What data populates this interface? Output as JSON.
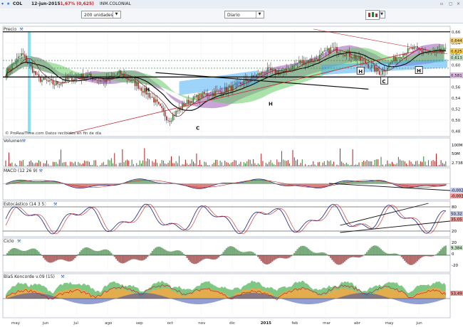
{
  "header": {
    "ticker": "COL",
    "date": "12-jun-2015",
    "change": "-1,67% (0,625)",
    "company": "INM.COLONIAL"
  },
  "toolbar": {
    "units_select": "200 unidades",
    "period_select": "Diario"
  },
  "watermark": "© ProRealTime.com  Datos recibidos en fin de día",
  "panels": {
    "price": "Precio",
    "volume": "Volumen",
    "macd": "MACD (12 26 9)",
    "stoch": "Estocástico (14 3 5)",
    "cycle": "Ciclo",
    "koncorde": "BlaS Koncorde v.09 (15)"
  },
  "price_ticks": [
    "0,66",
    "0,64",
    "0,62",
    "0,60",
    "0,58",
    "0,56",
    "0,54",
    "0,52",
    "0,50",
    "0,48"
  ],
  "price_badges": [
    "0,644",
    "0,625",
    "0,613",
    "0,581"
  ],
  "volume_ticks": [
    "100M",
    "50M"
  ],
  "volume_badge": "2.738",
  "macd_badges": [
    "-0,002",
    "-0,003"
  ],
  "stoch_ticks": [
    "80",
    "20"
  ],
  "stoch_badges": [
    "50,32",
    "35,05"
  ],
  "cycle_ticks": [
    "20",
    "0",
    "-20"
  ],
  "cycle_badge": "9,384",
  "koncorde_badge": "53,49",
  "pattern_labels": [
    "H",
    "C",
    "H",
    "H",
    "C",
    "H"
  ],
  "months": [
    "may",
    "jun",
    "jul",
    "ago",
    "sep",
    "oct",
    "nov",
    "dic",
    "2015",
    "feb",
    "mar",
    "abr",
    "may",
    "jun"
  ],
  "colors": {
    "candle_up": "#2e7d32",
    "candle_down": "#b71c1c",
    "cloud_purple": "#9b59b6",
    "cloud_green": "#66cc66",
    "cloud_blue": "#3fa9f5",
    "axis_blue": "#1f3fae"
  },
  "chart_data": {
    "type": "line",
    "title": "COL",
    "x_range": [
      "2014-05",
      "2015-06-12"
    ],
    "ylim": [
      0.47,
      0.67
    ],
    "series": [
      {
        "values": [
          0.585,
          0.62,
          0.575,
          0.565,
          0.575,
          0.58,
          0.57,
          0.585,
          0.565,
          0.54,
          0.5,
          0.53,
          0.545,
          0.55,
          0.56,
          0.575,
          0.59,
          0.585,
          0.605,
          0.61,
          0.63,
          0.62,
          0.605,
          0.585,
          0.615,
          0.63,
          0.62,
          0.625
        ]
      }
    ],
    "last_close": 0.625,
    "markers": [
      "0,644",
      "0,613",
      "0,581"
    ]
  }
}
